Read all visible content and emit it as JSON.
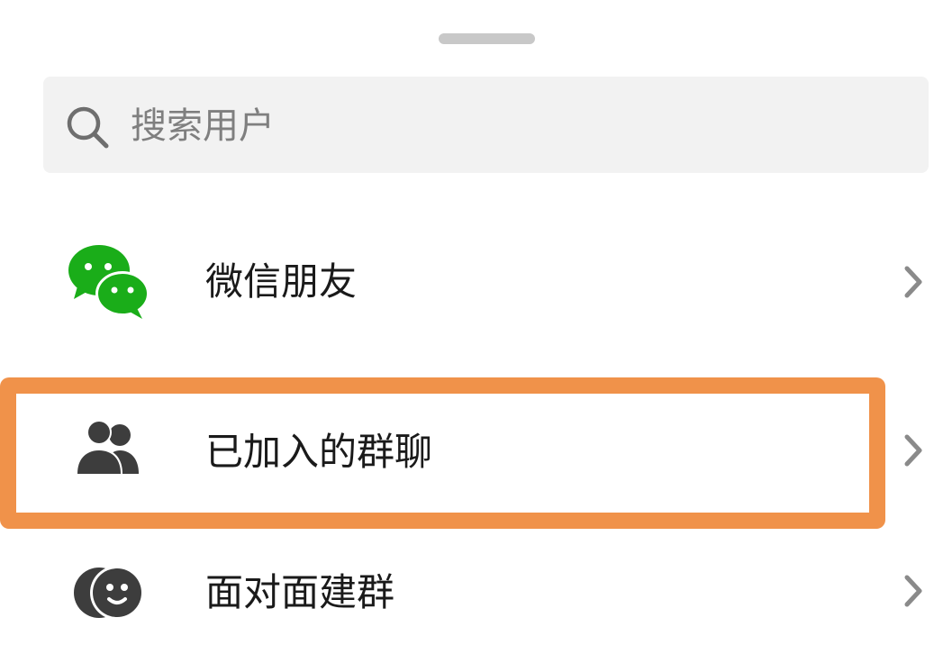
{
  "search": {
    "placeholder": "搜索用户",
    "icon": "search-icon"
  },
  "items": [
    {
      "label": "微信朋友",
      "icon": "wechat-icon",
      "chevron": "chevron-right-icon"
    },
    {
      "label": "已加入的群聊",
      "icon": "group-icon",
      "chevron": "chevron-right-icon",
      "highlighted": true
    },
    {
      "label": "面对面建群",
      "icon": "face-to-face-icon",
      "chevron": "chevron-right-icon"
    }
  ],
  "colors": {
    "wechat_green": "#1aad19",
    "icon_dark": "#3d3d3d",
    "highlight": "#f0924a",
    "search_bg": "#f2f2f2"
  }
}
